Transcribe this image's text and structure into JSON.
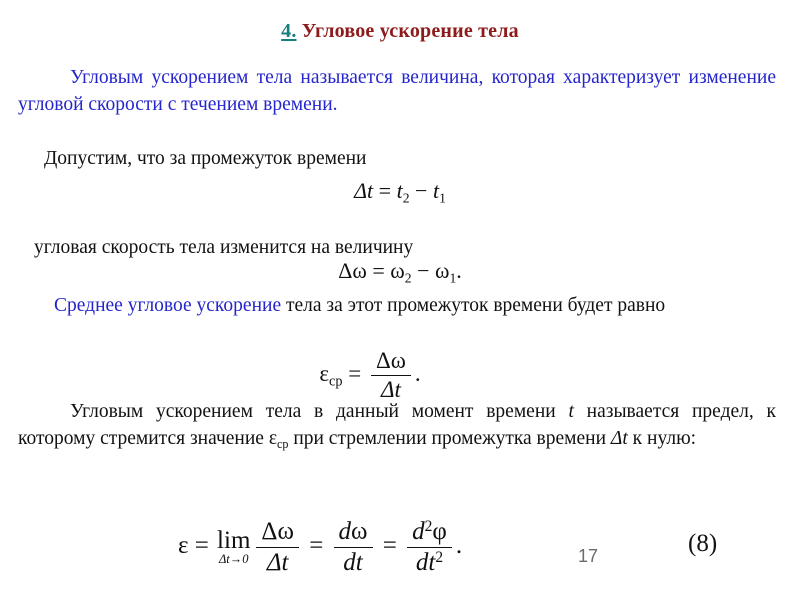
{
  "slide": {
    "title": {
      "number": "4.",
      "text": " Угловое ускорение тела",
      "number_color": "#17807f",
      "text_color": "#8e1b1b"
    },
    "paragraphs": {
      "definition_intro": "Угловым ускорением тела называется величина, которая характеризует изменение угловой скорости с течением времени.",
      "assume_line": "Допустим, что за промежуток времени",
      "omega_change_line": "угловая скорость тела изменится на величину",
      "average_lead_highlight": "Среднее угловое ускорение",
      "average_lead_rest": " тела за этот промежуток времени будет равно",
      "limit_definition_part1": "Угловым ускорением тела в данный момент времени ",
      "limit_definition_var_t": "t",
      "limit_definition_part2": " называется предел, к которому стремится значение ",
      "limit_definition_eps": "ε",
      "limit_definition_eps_sub": "ср",
      "limit_definition_part3": " при стремлении промежутка времени ",
      "limit_definition_delta_t": "Δt",
      "limit_definition_part4": " к нулю:"
    },
    "equations": {
      "delta_t": {
        "lhs_delta": "Δ",
        "lhs_var": "t",
        "eq": " = ",
        "t2": "t",
        "t2_sub": "2",
        "minus": " − ",
        "t1": "t",
        "t1_sub": "1"
      },
      "delta_omega": {
        "lhs_delta": "Δ",
        "lhs_var": "ω",
        "eq": " = ",
        "w2": "ω",
        "w2_sub": "2",
        "minus": " − ",
        "w1": "ω",
        "w1_sub": "1",
        "period": "."
      },
      "average_eps": {
        "eps": "ε",
        "eps_sub": "ср",
        "eq": " = ",
        "numerator": "Δω",
        "denominator": "Δt",
        "period": "."
      },
      "instant_eps": {
        "eps": "ε",
        "eq1": " = ",
        "lim": "lim",
        "lim_sub": "Δt→0",
        "frac1_num": "Δω",
        "frac1_den": "Δt",
        "eq2": " = ",
        "frac2_num_d": "d",
        "frac2_num_var": "ω",
        "frac2_den": "dt",
        "eq3": " = ",
        "frac3_num_d": "d",
        "frac3_num_sup": "2",
        "frac3_num_var": "φ",
        "frac3_den_dt": "dt",
        "frac3_den_sup": "2",
        "period": "."
      }
    },
    "equation_number": "(8)",
    "page_number": "17",
    "colors": {
      "blue_text": "#2525cc",
      "title_red": "#8e1b1b",
      "title_teal": "#17807f",
      "body_black": "#111111",
      "page_number_gray": "#6b6b6b"
    }
  }
}
